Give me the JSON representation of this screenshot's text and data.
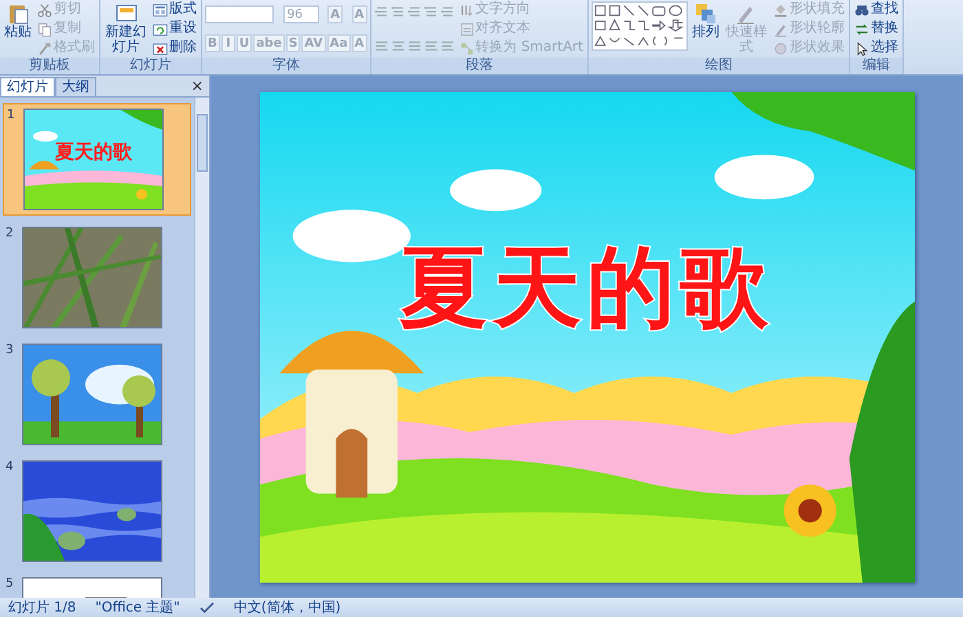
{
  "ribbon": {
    "groups": [
      {
        "name": "剪贴板",
        "parts": [
          [
            {
              "kind": "big",
              "label": "粘贴",
              "disabled": false
            }
          ],
          [
            {
              "kind": "small",
              "label": "剪切",
              "disabled": true
            },
            {
              "kind": "small",
              "label": "复制",
              "disabled": true
            },
            {
              "kind": "small",
              "label": "格式刷",
              "disabled": true
            }
          ]
        ]
      },
      {
        "name": "幻灯片",
        "parts": [
          [
            {
              "kind": "big",
              "label": "新建幻灯片",
              "disabled": false
            }
          ],
          [
            {
              "kind": "small",
              "label": "版式",
              "disabled": false
            },
            {
              "kind": "small",
              "label": "重设",
              "disabled": false
            },
            {
              "kind": "small",
              "label": "删除",
              "disabled": false
            }
          ]
        ]
      },
      {
        "name": "字体",
        "field_line": [
          {
            "kind": "blank-field"
          },
          {
            "kind": "field",
            "value": "96",
            "disabled": true
          },
          {
            "kind": "glyph",
            "label": "A",
            "disabled": true
          },
          {
            "kind": "glyph",
            "label": "A",
            "disabled": true
          }
        ],
        "format_line": [
          {
            "kind": "glyph",
            "label": "B",
            "disabled": true
          },
          {
            "kind": "glyph",
            "label": "I",
            "disabled": true
          },
          {
            "kind": "glyph",
            "label": "U",
            "disabled": true
          },
          {
            "kind": "glyph",
            "label": "abe",
            "disabled": true
          },
          {
            "kind": "glyph",
            "label": "S",
            "disabled": true
          },
          {
            "kind": "glyph",
            "label": "AV",
            "disabled": true
          },
          {
            "kind": "glyph",
            "label": "Aa",
            "disabled": true
          },
          {
            "kind": "glyph",
            "label": "A",
            "disabled": true
          }
        ]
      },
      {
        "name": "段落",
        "parts": [
          [
            {
              "kind": "list-icons"
            },
            {
              "kind": "align-icons"
            }
          ],
          [
            {
              "kind": "small",
              "label": "文字方向",
              "disabled": true
            },
            {
              "kind": "small",
              "label": "对齐文本",
              "disabled": true
            },
            {
              "kind": "small",
              "label": "转换为 SmartArt",
              "disabled": true
            }
          ]
        ]
      },
      {
        "name": "绘图",
        "parts": [
          [
            {
              "kind": "shapes-gallery"
            }
          ],
          [
            {
              "kind": "big",
              "label": "排列",
              "disabled": false
            }
          ],
          [
            {
              "kind": "big",
              "label": "快速样式",
              "disabled": true
            }
          ],
          [
            {
              "kind": "small",
              "label": "形状填充",
              "disabled": true
            },
            {
              "kind": "small",
              "label": "形状轮廓",
              "disabled": true
            },
            {
              "kind": "small",
              "label": "形状效果",
              "disabled": true
            }
          ]
        ]
      },
      {
        "name": "编辑",
        "parts": [
          [
            {
              "kind": "small",
              "label": "查找",
              "disabled": false
            },
            {
              "kind": "small",
              "label": "替换",
              "disabled": false
            },
            {
              "kind": "small",
              "label": "选择",
              "disabled": false
            }
          ]
        ]
      }
    ]
  },
  "pane": {
    "tabs": [
      {
        "label": "幻灯片",
        "selected": true
      },
      {
        "label": "大纲",
        "selected": false
      }
    ],
    "close": "×",
    "thumbnails": [
      {
        "number": "1",
        "selected": true,
        "title": "夏天的歌"
      },
      {
        "number": "2",
        "selected": false
      },
      {
        "number": "3",
        "selected": false
      },
      {
        "number": "4",
        "selected": false
      },
      {
        "number": "5",
        "selected": false
      }
    ]
  },
  "slide": {
    "title": "夏天的歌"
  },
  "status_bar": {
    "slide": "幻灯片 1/8",
    "theme": "\"Office 主题\"",
    "language": "中文(简体，中国)"
  }
}
